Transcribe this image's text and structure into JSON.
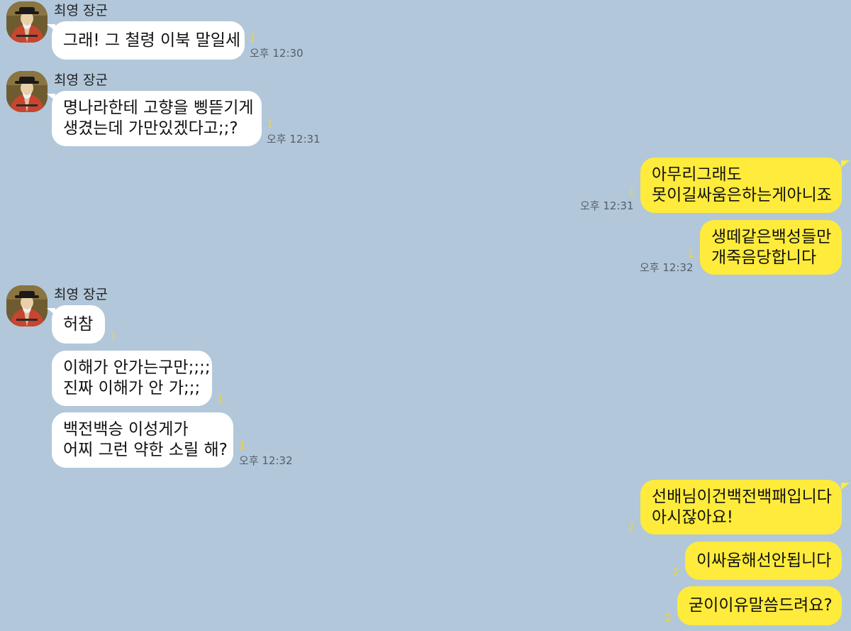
{
  "sender_name": "최영 장군",
  "messages": [
    {
      "id": "m1",
      "lines": [
        "그래! 그 철령 이북 말일세"
      ],
      "unread": "1",
      "time": "오후 12:30"
    },
    {
      "id": "m2",
      "lines": [
        "명나라한테 고향을 삥뜯기게",
        "생겼는데 가만있겠다고;;?"
      ],
      "unread": "1",
      "time": "오후 12:31"
    },
    {
      "id": "m3",
      "lines": [
        "아무리그래도",
        "못이길싸움은하는게아니죠"
      ],
      "unread": "1",
      "time": "오후 12:31"
    },
    {
      "id": "m4",
      "lines": [
        "생떼같은백성들만",
        "개죽음당합니다"
      ],
      "unread": "1",
      "time": "오후 12:32"
    },
    {
      "id": "m5",
      "lines": [
        "허참"
      ],
      "unread": "1"
    },
    {
      "id": "m6",
      "lines": [
        "이해가 안가는구만;;;;",
        "진짜 이해가 안 가;;;"
      ],
      "unread": "1"
    },
    {
      "id": "m7",
      "lines": [
        "백전백승 이성게가",
        "어찌 그런 약한 소릴 해?"
      ],
      "unread": "1",
      "time": "오후 12:32"
    },
    {
      "id": "m8",
      "lines": [
        "선배님이건백전백패입니다",
        "아시잖아요!"
      ],
      "unread": "2"
    },
    {
      "id": "m9",
      "lines": [
        "이싸움해선안됩니다"
      ],
      "unread": "2"
    },
    {
      "id": "m10",
      "lines": [
        "굳이이유말씀드려요?"
      ],
      "unread": "2"
    }
  ],
  "colors": {
    "background": "#b2c7da",
    "incoming_bubble": "#ffffff",
    "outgoing_bubble": "#ffeb3b",
    "unread_count": "#f5d42c"
  }
}
